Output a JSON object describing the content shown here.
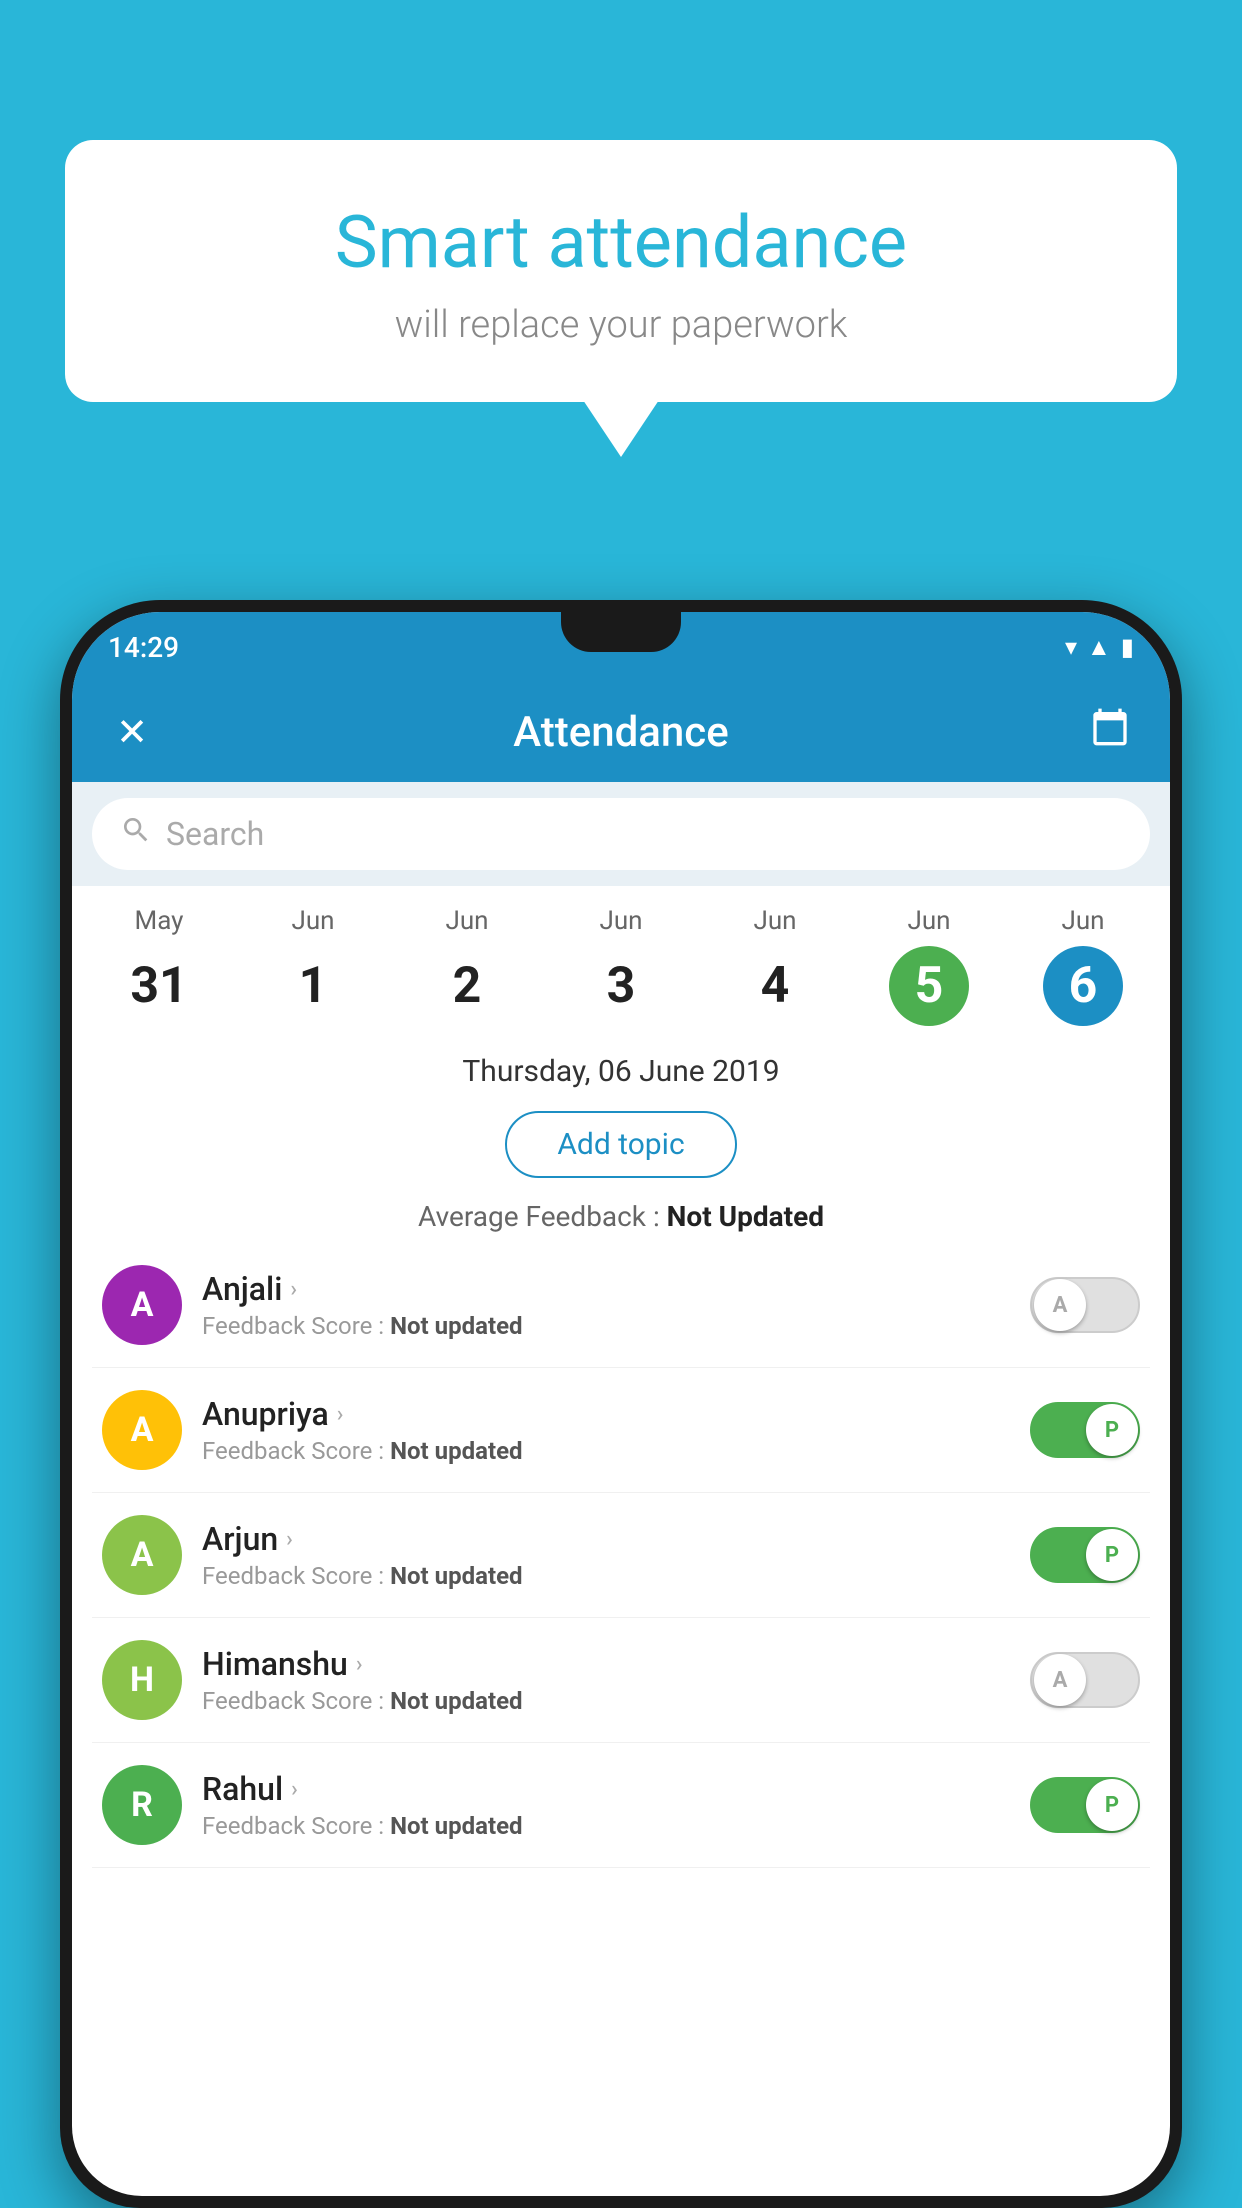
{
  "background_color": "#29b6d8",
  "speech_bubble": {
    "title": "Smart attendance",
    "subtitle": "will replace your paperwork"
  },
  "status_bar": {
    "time": "14:29",
    "icons": [
      "wifi",
      "signal",
      "battery"
    ]
  },
  "app_bar": {
    "close_icon": "✕",
    "title": "Attendance",
    "calendar_icon": "📅"
  },
  "search": {
    "placeholder": "Search"
  },
  "calendar": {
    "days": [
      {
        "month": "May",
        "num": "31",
        "state": "normal"
      },
      {
        "month": "Jun",
        "num": "1",
        "state": "normal"
      },
      {
        "month": "Jun",
        "num": "2",
        "state": "normal"
      },
      {
        "month": "Jun",
        "num": "3",
        "state": "normal"
      },
      {
        "month": "Jun",
        "num": "4",
        "state": "normal"
      },
      {
        "month": "Jun",
        "num": "5",
        "state": "today-green"
      },
      {
        "month": "Jun",
        "num": "6",
        "state": "selected-blue"
      }
    ]
  },
  "selected_date": "Thursday, 06 June 2019",
  "add_topic_label": "Add topic",
  "avg_feedback_label": "Average Feedback : ",
  "avg_feedback_value": "Not Updated",
  "students": [
    {
      "name": "Anjali",
      "initial": "A",
      "avatar_color": "#9c27b0",
      "feedback_label": "Feedback Score : ",
      "feedback_value": "Not updated",
      "toggle": "off",
      "toggle_label": "A"
    },
    {
      "name": "Anupriya",
      "initial": "A",
      "avatar_color": "#ffc107",
      "feedback_label": "Feedback Score : ",
      "feedback_value": "Not updated",
      "toggle": "on",
      "toggle_label": "P"
    },
    {
      "name": "Arjun",
      "initial": "A",
      "avatar_color": "#8bc34a",
      "feedback_label": "Feedback Score : ",
      "feedback_value": "Not updated",
      "toggle": "on",
      "toggle_label": "P"
    },
    {
      "name": "Himanshu",
      "initial": "H",
      "avatar_color": "#8bc34a",
      "feedback_label": "Feedback Score : ",
      "feedback_value": "Not updated",
      "toggle": "off",
      "toggle_label": "A"
    },
    {
      "name": "Rahul",
      "initial": "R",
      "avatar_color": "#4caf50",
      "feedback_label": "Feedback Score : ",
      "feedback_value": "Not updated",
      "toggle": "on",
      "toggle_label": "P"
    }
  ]
}
